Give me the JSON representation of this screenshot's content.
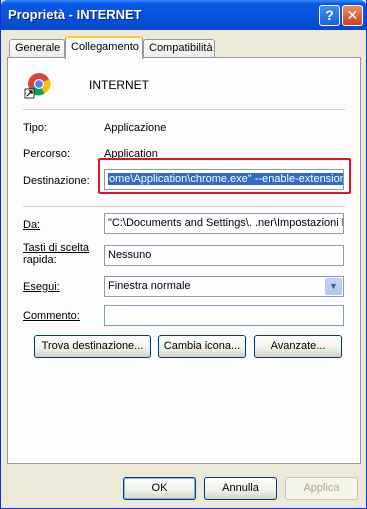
{
  "window": {
    "title": "Proprietà - INTERNET",
    "help_glyph": "?",
    "close_glyph": "✕"
  },
  "tabs": [
    {
      "label": "Generale"
    },
    {
      "label": "Collegamento",
      "active": true
    },
    {
      "label": "Compatibilità"
    }
  ],
  "shortcut": {
    "name": "INTERNET",
    "type_label": "Tipo:",
    "type_value": "Applicazione",
    "path_label": "Percorso:",
    "path_value": "Application",
    "target_label": "Destinazione:",
    "target_value": "ome\\Application\\chrome.exe\" --enable-extensions",
    "start_in_label": "Da:",
    "start_in_value": "\"C:\\Documents and Settings\\.  .ner\\Impostazioni lo",
    "hotkey_label_line1": "Tasti di scelta",
    "hotkey_label_line2": "rapida:",
    "hotkey_value": "Nessuno",
    "run_label": "Esegui:",
    "run_value": "Finestra normale",
    "comment_label": "Commento:",
    "comment_value": ""
  },
  "actions": {
    "find_target": "Trova destinazione...",
    "change_icon": "Cambia icona...",
    "advanced": "Avanzate..."
  },
  "footer": {
    "ok": "OK",
    "cancel": "Annulla",
    "apply": "Applica"
  },
  "colors": {
    "highlight": "#d9181f",
    "selection": "#316ac5",
    "titlebar": "#0854e3"
  },
  "icons": {
    "app": "chrome-shortcut-icon",
    "dropdown": "chevron-down-icon"
  }
}
